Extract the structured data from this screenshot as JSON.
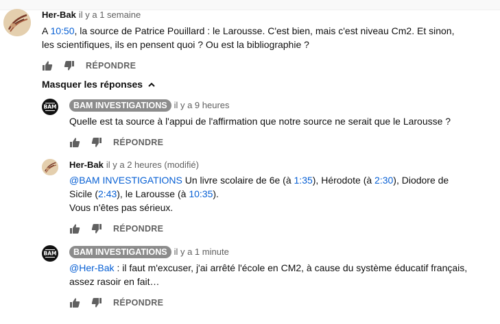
{
  "comments": [
    {
      "author": "Her-Bak",
      "time": "il y a 1 semaine",
      "line1_pre": "A ",
      "line1_link": "10:50",
      "line1_post": ", la source de Patrice Pouillard : le Larousse. C'est bien, mais c'est niveau Cm2. Et sinon,",
      "line2": "les scientifiques, ils en pensent quoi ? Ou est la bibliographie ?",
      "reply_label": "RÉPONDRE"
    }
  ],
  "replies_toggle": "Masquer les réponses",
  "replies": [
    {
      "author": "BAM INVESTIGATIONS",
      "time": "il y a 9 heures",
      "text": "Quelle est ta source à l'appui de l'affirmation que notre source ne serait que le Larousse ?",
      "reply_label": "RÉPONDRE"
    },
    {
      "author": "Her-Bak",
      "time": "il y a 2 heures (modifié)",
      "mention": "@BAM INVESTIGATIONS",
      "l1_a": " Un livre scolaire de 6e (à ",
      "t1": "1:35",
      "l1_b": "), Hérodote (à ",
      "t2": "2:30",
      "l1_c": "), Diodore de",
      "l2_a": "Sicile (",
      "t3": "2:43",
      "l2_b": "), le Larousse (à ",
      "t4": "10:35",
      "l2_c": ").",
      "l3": "Vous n'êtes pas sérieux.",
      "reply_label": "RÉPONDRE"
    },
    {
      "author": "BAM INVESTIGATIONS",
      "time": "il y a 1 minute",
      "mention": "@Her-Bak",
      "l1": " : il faut m'excuser, j'ai arrêté l'école en CM2, à cause du système éducatif français,",
      "l2": "assez rasoir en fait…",
      "reply_label": "RÉPONDRE"
    }
  ],
  "bam_logo_text": "BAM",
  "icons": {
    "like": "thumbs-up-icon",
    "dislike": "thumbs-down-icon",
    "toggle": "chevron-up-icon"
  }
}
